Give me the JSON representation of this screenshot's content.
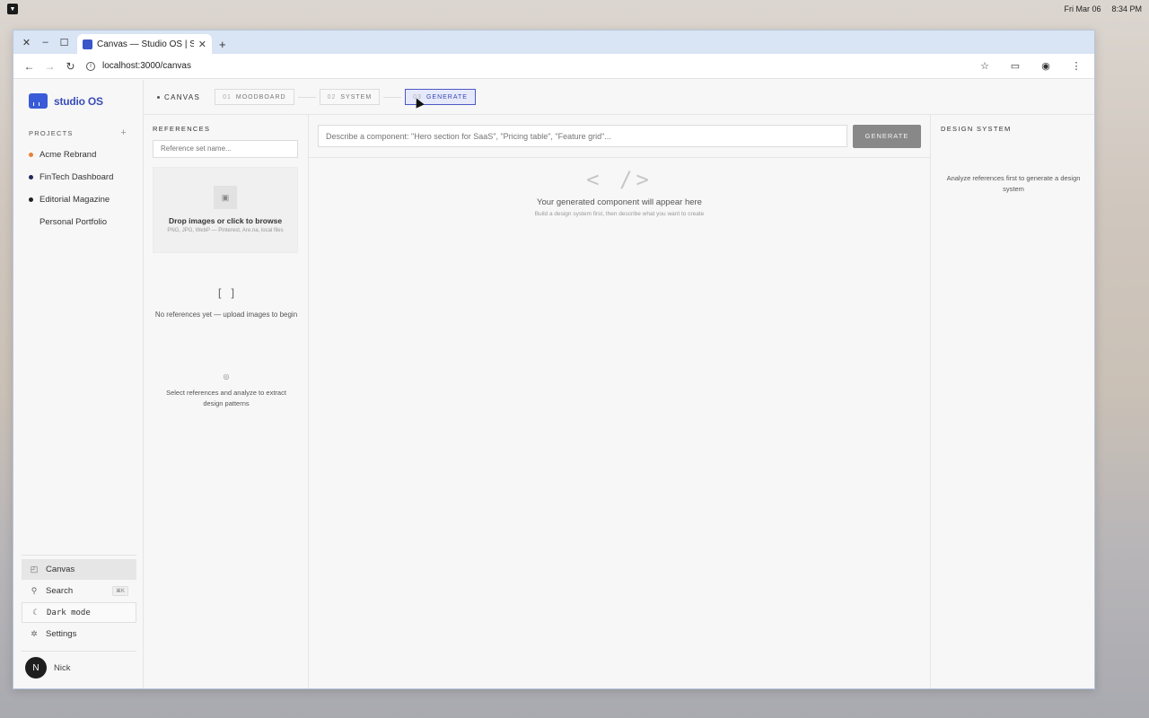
{
  "os": {
    "date": "Fri Mar 06",
    "time": "8:34 PM"
  },
  "browser": {
    "tab_title": "Canvas — Studio OS | Stu",
    "url": "localhost:3000/canvas"
  },
  "sidebar": {
    "brand": "studio OS",
    "projects_label": "PROJECTS",
    "projects": [
      {
        "name": "Acme Rebrand",
        "color": "#e8833a"
      },
      {
        "name": "FinTech Dashboard",
        "color": "#1e2a5a"
      },
      {
        "name": "Editorial Magazine",
        "color": "#222222"
      },
      {
        "name": "Personal Portfolio",
        "color": ""
      }
    ],
    "nav": {
      "canvas": "Canvas",
      "search": "Search",
      "search_shortcut": "⌘K",
      "dark_mode": "Dark mode",
      "settings": "Settings"
    },
    "user": {
      "initial": "N",
      "name": "Nick"
    }
  },
  "steps": {
    "canvas": "CANVAS",
    "items": [
      {
        "num": "01",
        "label": "MOODBOARD"
      },
      {
        "num": "02",
        "label": "SYSTEM"
      },
      {
        "num": "03",
        "label": "GENERATE"
      }
    ]
  },
  "references": {
    "title": "REFERENCES",
    "input_placeholder": "Reference set name...",
    "drop_title": "Drop images or click to browse",
    "drop_sub": "PNG, JPG, WebP — Pinterest, Are.na, local files",
    "empty_glyph": "[ ]",
    "empty_text": "No references yet — upload images to begin",
    "analyze_glyph": "◎",
    "analyze_text": "Select references and analyze to extract design patterns"
  },
  "generate": {
    "input_placeholder": "Describe a component: \"Hero section for SaaS\", \"Pricing table\", \"Feature grid\"...",
    "button": "GENERATE",
    "glyph": "< />",
    "title": "Your generated component will appear here",
    "sub": "Build a design system first, then describe what you want to create"
  },
  "design_system": {
    "title": "DESIGN SYSTEM",
    "text": "Analyze references first to generate a design system"
  }
}
